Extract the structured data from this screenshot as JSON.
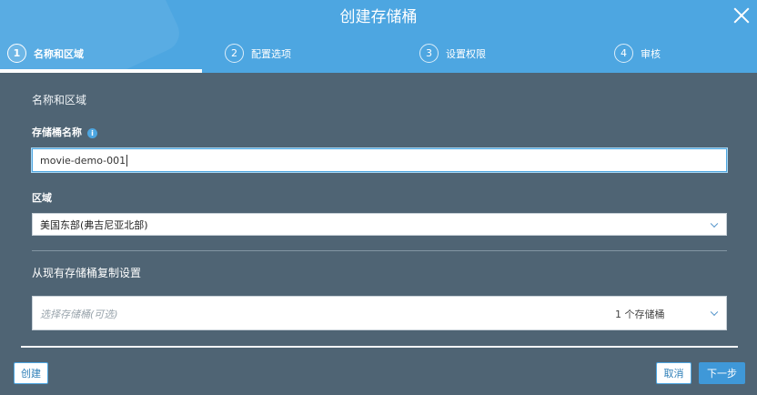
{
  "dialog": {
    "title": "创建存储桶"
  },
  "steps": [
    {
      "number": "1",
      "label": "名称和区域",
      "active": true
    },
    {
      "number": "2",
      "label": "配置选项",
      "active": false
    },
    {
      "number": "3",
      "label": "设置权限",
      "active": false
    },
    {
      "number": "4",
      "label": "审核",
      "active": false
    }
  ],
  "form": {
    "section_title": "名称和区域",
    "bucket_name_label": "存储桶名称",
    "bucket_name_value": "movie-demo-001",
    "region_label": "区域",
    "region_value": "美国东部(弗吉尼亚北部)",
    "copy_title": "从现有存储桶复制设置",
    "copy_placeholder": "选择存储桶(可选)",
    "copy_count": "1 个存储桶"
  },
  "footer": {
    "create_label": "创建",
    "cancel_label": "取消",
    "next_label": "下一步"
  },
  "colors": {
    "header": "#4da6e1",
    "body": "#4f6474",
    "accent": "#3f98d8"
  },
  "icons": [
    "close-icon",
    "info-icon",
    "chevron-down-icon"
  ]
}
